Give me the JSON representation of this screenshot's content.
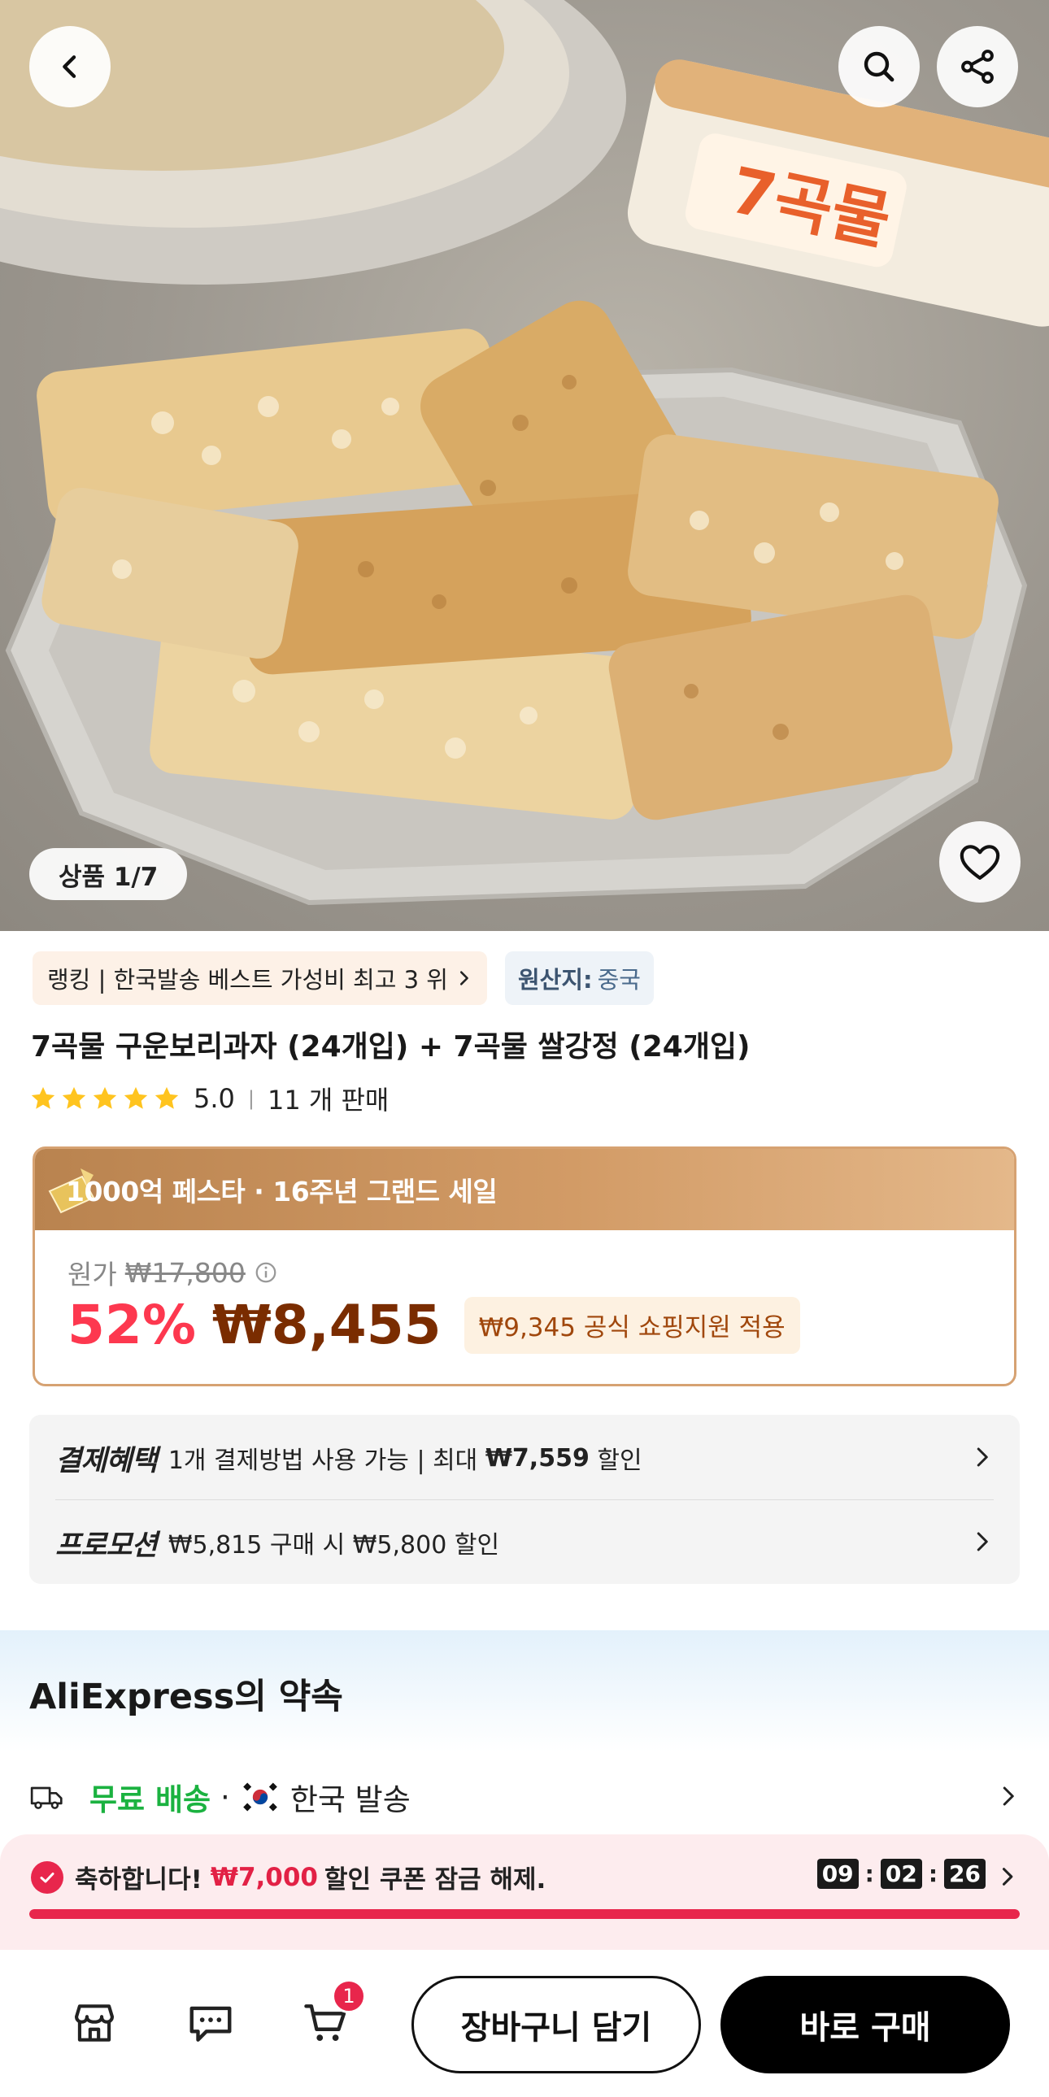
{
  "gallery": {
    "counter": "상품 1/7",
    "package_text": "7곡물"
  },
  "product": {
    "ranking_tag": "랭킹 | 한국발송 베스트 가성비 최고 3 위",
    "origin_label": "원산지:",
    "origin_value": "중국",
    "title": "7곡물 구운보리과자 (24개입) + 7곡물 쌀강정 (24개입)",
    "rating": "5.0",
    "sold": "11 개 판매",
    "star_count": 5
  },
  "price": {
    "sale_banner": "1000억 페스타 · 16주년 그랜드 세일",
    "original_label": "원가",
    "original_price": "₩17,800",
    "discount": "52%",
    "sale_price": "₩8,455",
    "shopping_support": "₩9,345 공식 쇼핑지원 적용"
  },
  "benefits": {
    "payment_label": "결제혜택",
    "payment_text": "1개 결제방법 사용 가능 | 최대 ",
    "payment_amount": "₩7,559",
    "payment_suffix": " 할인",
    "promo_label": "프로모션",
    "promo_text": "₩5,815 구매 시 ₩5,800 할인"
  },
  "promise": {
    "title": "AliExpress의 약속",
    "free_shipping": "무료 배송",
    "dot": "·",
    "from_korea": "한국 발송"
  },
  "coupon": {
    "prefix": "축하합니다!",
    "amount": "₩7,000",
    "suffix": "할인 쿠폰 잠금 해제.",
    "timer_h": "09",
    "timer_m": "02",
    "timer_s": "26",
    "colon": ":",
    "progress": 1.0
  },
  "bottom_bar": {
    "cart_badge": "1",
    "add_to_cart": "장바구니 담기",
    "buy_now": "바로 구매"
  },
  "colors": {
    "accent_red": "#fd384f",
    "price_brown": "#7a2c00",
    "free_green": "#1bb240",
    "banner_gold": "#c9915c"
  }
}
